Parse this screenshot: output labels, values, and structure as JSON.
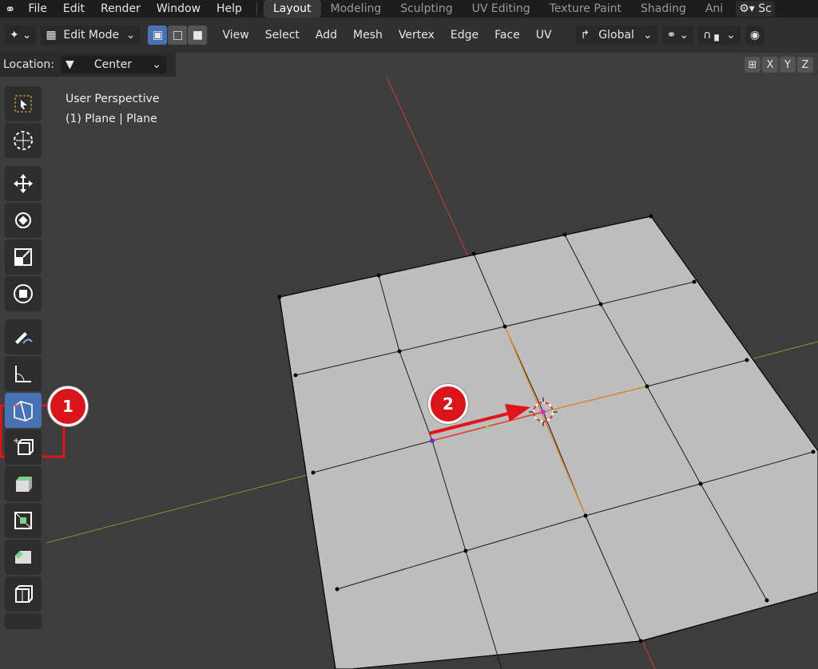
{
  "topbar": {
    "menus": [
      "File",
      "Edit",
      "Render",
      "Window",
      "Help"
    ],
    "workspaces": [
      "Layout",
      "Modeling",
      "Sculpting",
      "UV Editing",
      "Texture Paint",
      "Shading",
      "Ani"
    ],
    "active_workspace": "Layout",
    "scene_label": "Sc"
  },
  "header": {
    "mode": "Edit Mode",
    "menus": [
      "View",
      "Select",
      "Add",
      "Mesh",
      "Vertex",
      "Edge",
      "Face",
      "UV"
    ],
    "transform_orientation": "Global"
  },
  "subheader": {
    "location_label": "Location:",
    "location_value": "Center",
    "axes": [
      "X",
      "Y",
      "Z"
    ]
  },
  "viewport": {
    "view_name": "User Perspective",
    "object_info": "(1) Plane | Plane"
  },
  "tools": [
    "select-box",
    "cursor",
    "move",
    "rotate",
    "scale",
    "transform",
    "annotate",
    "measure",
    "knife-edge-slide",
    "add-cube",
    "extrude-region",
    "inset-faces",
    "bevel",
    "loop-cut",
    "offset-edge"
  ],
  "active_tool": "knife-edge-slide",
  "callouts": [
    "1",
    "2"
  ],
  "colors": {
    "accent": "#4772b3",
    "callout": "#d9151b",
    "mesh_face": "#bcbcbc",
    "x_axis": "#c04040",
    "y_axis": "#6fa02a"
  }
}
